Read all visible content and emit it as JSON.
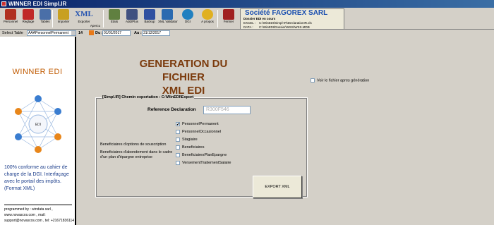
{
  "window": {
    "title": "WINNER EDI Simpl.IR"
  },
  "toolbar": {
    "buttons": [
      {
        "label": "Personnel",
        "icon": "people-icon",
        "color": "#b03020"
      },
      {
        "label": "Reglage",
        "icon": "tools-icon",
        "color": "#c02828"
      },
      {
        "label": "Tables",
        "icon": "table-icon",
        "color": "#4a6fa8"
      },
      {
        "label": "Importer",
        "icon": "import-icon",
        "color": "#c8a020"
      },
      {
        "label": "Exporter",
        "icon": "xml-export-icon",
        "color": "#2050b0"
      },
      {
        "label": "Apercu",
        "icon": "preview-icon",
        "color": "#3a8a3a"
      },
      {
        "label": "Etats",
        "icon": "reports-icon",
        "color": "#608040"
      },
      {
        "label": "Add/Plus",
        "icon": "add-icon",
        "color": "#405080"
      },
      {
        "label": "Backup",
        "icon": "backup-icon",
        "color": "#3050a0"
      },
      {
        "label": "XML Validator",
        "icon": "validator-icon",
        "color": "#2a6ab0"
      },
      {
        "label": "DGI",
        "icon": "dgi-icon",
        "color": "#2080c0"
      },
      {
        "label": "A propos",
        "icon": "about-icon",
        "color": "#e0b020"
      },
      {
        "label": "Fermer",
        "icon": "exit-icon",
        "color": "#a02020"
      }
    ],
    "xml_text": "XML"
  },
  "company": {
    "name": "Société FAGOREX SARL",
    "dossier_label": "Dossier EDI en cours",
    "excel_label": "EXCEL :",
    "excel_path": "C:\\WinEDI\\Simpl-IR\\DeclarationIR.xls",
    "data_label": "DATA :",
    "data_path": "C:\\WinEDI\\Dossier\\WSS\\WSS.MDB"
  },
  "selbar": {
    "select_label": "Select Table",
    "table_value": "AAAPersonnelPermanent",
    "count": "14",
    "from_label": "Du :",
    "from_value": "01/01/2017",
    "to_label": "Au :",
    "to_value": "31/12/2017"
  },
  "left": {
    "brand": "WINNER EDI",
    "center_label": "EDI",
    "tagline": "100% conforme au cahier de charge de la DGI. Interfaçage avec le portail des impôts. (Format XML)",
    "credit": "programmed by : windata sarl , www.novascos.com , mail: support@novascos.com , tel: +21671836114"
  },
  "main": {
    "heading_line1": "GENERATION DU FICHIER",
    "heading_line2": "XML EDI",
    "show_file_label": "Voir le fichier apres génération",
    "group_title": "[Simpl.IR] Chemin exportation : C:\\WinEDI\\Export",
    "ref_label": "Reference Declaration",
    "ref_value": "R300F546",
    "types": [
      {
        "label": "PersonnelPermanent",
        "checked": true
      },
      {
        "label": "PersonnelOccasionnel",
        "checked": false
      },
      {
        "label": "Stagiaire",
        "checked": false
      },
      {
        "label": "Beneficiaires",
        "checked": false
      },
      {
        "label": "BeneficiairesPlanEpargne",
        "checked": false
      },
      {
        "label": "VersementTraitementSalaire",
        "checked": false
      }
    ],
    "side_label_1": "Beneficiaires d'options de souscription",
    "side_label_2": "Beneficiaires d'abondement dans le cadre d'un plan d'épargne entreprise",
    "export_label": "EXPORT XML"
  }
}
